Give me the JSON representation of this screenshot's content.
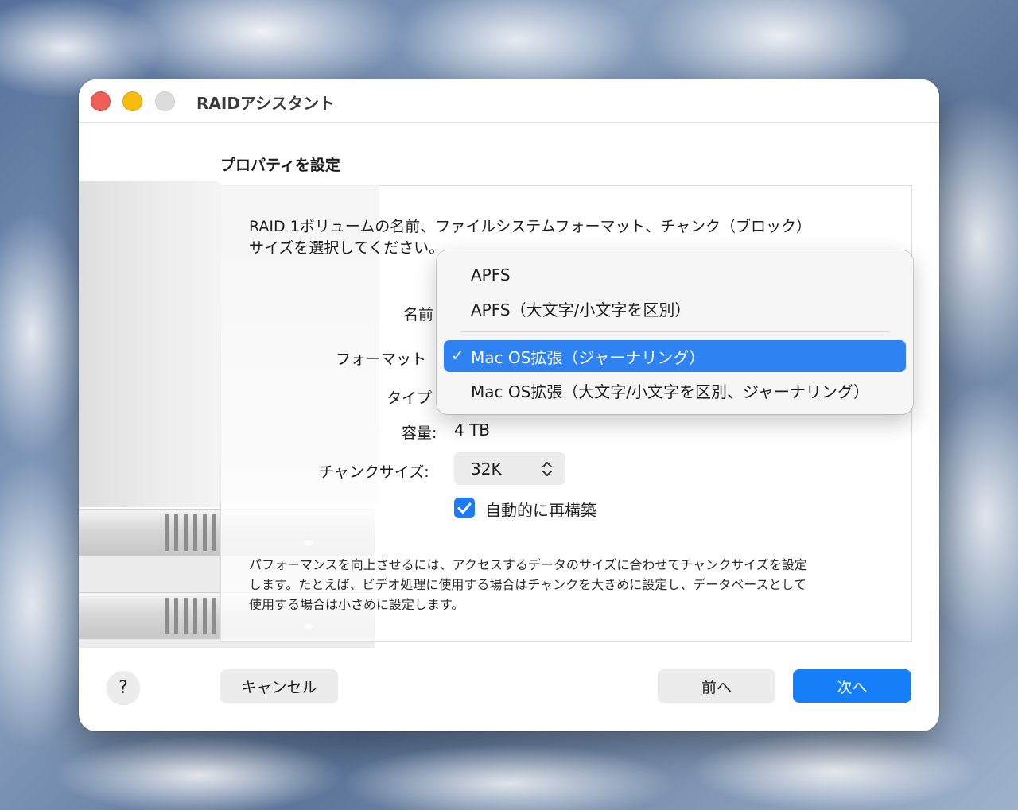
{
  "window": {
    "title": "RAIDアシスタント"
  },
  "panel": {
    "section_title": "プロパティを設定",
    "description_line1": "RAID 1ボリュームの名前、ファイルシステムフォーマット、チャンク（ブロック）",
    "description_line2": "サイズを選択してください。"
  },
  "form": {
    "name_label": "名前",
    "format_label": "フォーマット",
    "type_label": "タイプ",
    "capacity_label": "容量:",
    "capacity_value": "4 TB",
    "chunk_label": "チャンクサイズ:",
    "chunk_value": "32K",
    "rebuild_label": "自動的に再構築",
    "rebuild_checked": true
  },
  "format_menu": {
    "options": [
      {
        "label": "APFS",
        "selected": false
      },
      {
        "label": "APFS（大文字/小文字を区別）",
        "selected": false
      },
      {
        "label": "Mac OS拡張（ジャーナリング）",
        "selected": true
      },
      {
        "label": "Mac OS拡張（大文字/小文字を区別、ジャーナリング）",
        "selected": false
      }
    ],
    "check_glyph": "✓"
  },
  "hint": {
    "line1": "パフォーマンスを向上させるには、アクセスするデータのサイズに合わせてチャンクサイズを設定",
    "line2": "します。たとえば、ビデオ処理に使用する場合はチャンクを大きめに設定し、データベースとして",
    "line3": "使用する場合は小さめに設定します。"
  },
  "buttons": {
    "help": "?",
    "cancel": "キャンセル",
    "back": "前へ",
    "next": "次へ"
  },
  "colors": {
    "accent": "#167ef8",
    "menu_selection": "#2f82f2",
    "close": "#ee5f58",
    "minimize": "#f6bd0f",
    "zoom_disabled": "#dcdcdc"
  },
  "icons": {
    "stepper": "up-down-chevron-icon",
    "checkbox": "checkmark-icon"
  }
}
